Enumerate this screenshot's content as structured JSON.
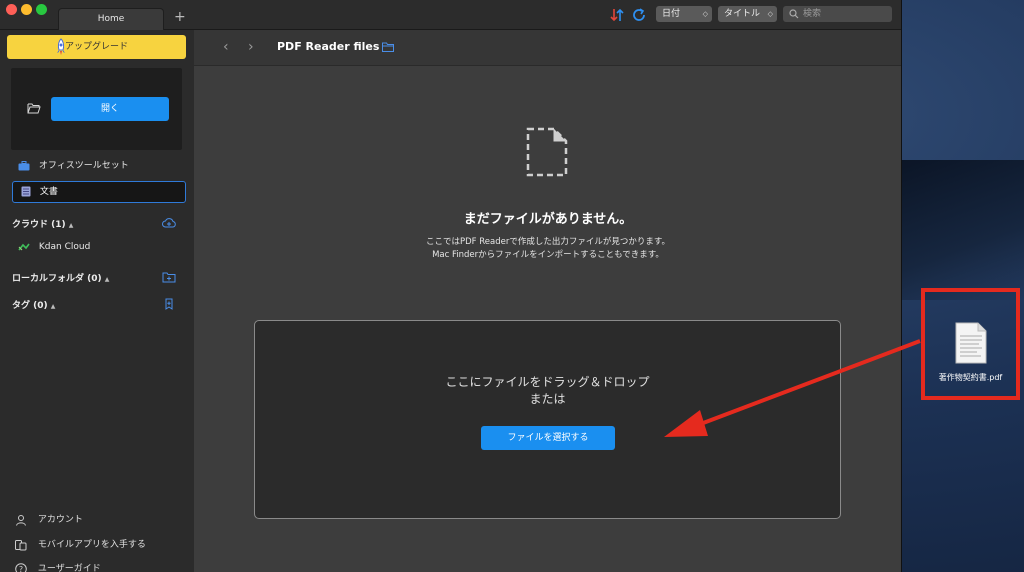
{
  "titlebar": {
    "tab_label": "Home",
    "add_tab": "+",
    "sort_select": "日付",
    "title_select": "タイトル",
    "search_placeholder": "検索"
  },
  "sidebar": {
    "upgrade_label": "アップグレード",
    "open_label": "開く",
    "office_tools": "オフィスツールセット",
    "documents": "文書",
    "cloud_section": "クラウド (1)",
    "kdan_cloud": "Kdan Cloud",
    "local_section": "ローカルフォルダ (0)",
    "tags_section": "タグ (0)",
    "account": "アカウント",
    "mobile_app": "モバイルアプリを入手する",
    "user_guide": "ユーザーガイド"
  },
  "main": {
    "path_title": "PDF Reader files",
    "empty_title": "まだファイルがありません。",
    "empty_line1": "ここではPDF Readerで作成した出力ファイルが見つかります。",
    "empty_line2": "Mac Finderからファイルをインポートすることもできます。",
    "drop_line1": "ここにファイルをドラッグ＆ドロップ",
    "drop_line2": "または",
    "choose_button": "ファイルを選択する"
  },
  "desktop": {
    "file_label": "著作物契約書.pdf"
  },
  "colors": {
    "accent_blue": "#1a8ff0",
    "upgrade_yellow": "#f7d33f",
    "annotation_red": "#e52a1e"
  }
}
